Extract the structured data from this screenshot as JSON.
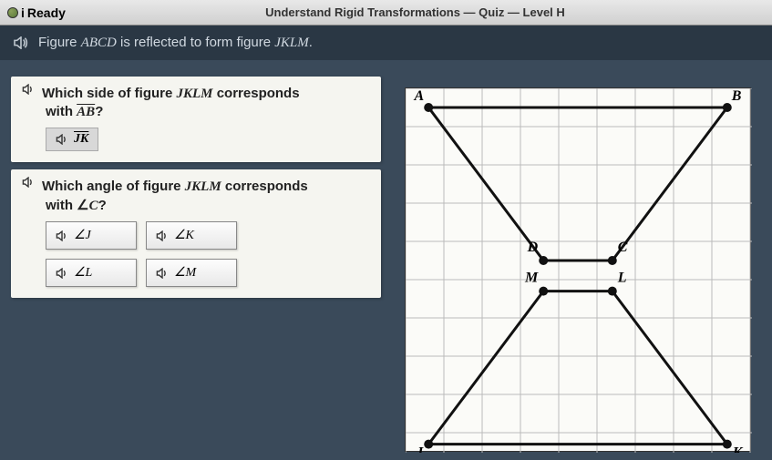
{
  "header": {
    "brand_prefix": "i",
    "brand_suffix": "Ready",
    "title": "Understand Rigid Transformations — Quiz — Level H"
  },
  "intro": "Figure ABCD is reflected to form figure JKLM.",
  "q1": {
    "line1": "Which side of figure JKLM corresponds",
    "line2": "with AB?",
    "answer": "JK"
  },
  "q2": {
    "line1": "Which angle of figure JKLM corresponds",
    "line2": "with ∠C?",
    "options": [
      "∠J",
      "∠K",
      "∠L",
      "∠M"
    ]
  },
  "chart_data": {
    "type": "diagram",
    "description": "Two congruent trapezoids on a grid. ABCD above, JKLM below (reflection).",
    "grid": {
      "cols": 9,
      "rows": 10,
      "cell": 42
    },
    "figures": [
      {
        "name": "ABCD",
        "vertices": {
          "A": {
            "gx": 0.6,
            "gy": 0.5
          },
          "B": {
            "gx": 8.4,
            "gy": 0.5
          },
          "C": {
            "gx": 5.4,
            "gy": 4.5
          },
          "D": {
            "gx": 3.6,
            "gy": 4.5
          }
        },
        "label_offsets": {
          "A": [
            -5,
            -8
          ],
          "B": [
            5,
            -8
          ],
          "C": [
            6,
            -10
          ],
          "D": [
            -6,
            -10
          ]
        }
      },
      {
        "name": "JKLM",
        "vertices": {
          "M": {
            "gx": 3.6,
            "gy": 5.3
          },
          "L": {
            "gx": 5.4,
            "gy": 5.3
          },
          "K": {
            "gx": 8.4,
            "gy": 9.3
          },
          "J": {
            "gx": 0.6,
            "gy": 9.3
          }
        },
        "label_offsets": {
          "M": [
            -6,
            -10
          ],
          "L": [
            6,
            -10
          ],
          "J": [
            -6,
            14
          ],
          "K": [
            6,
            14
          ]
        }
      }
    ]
  }
}
